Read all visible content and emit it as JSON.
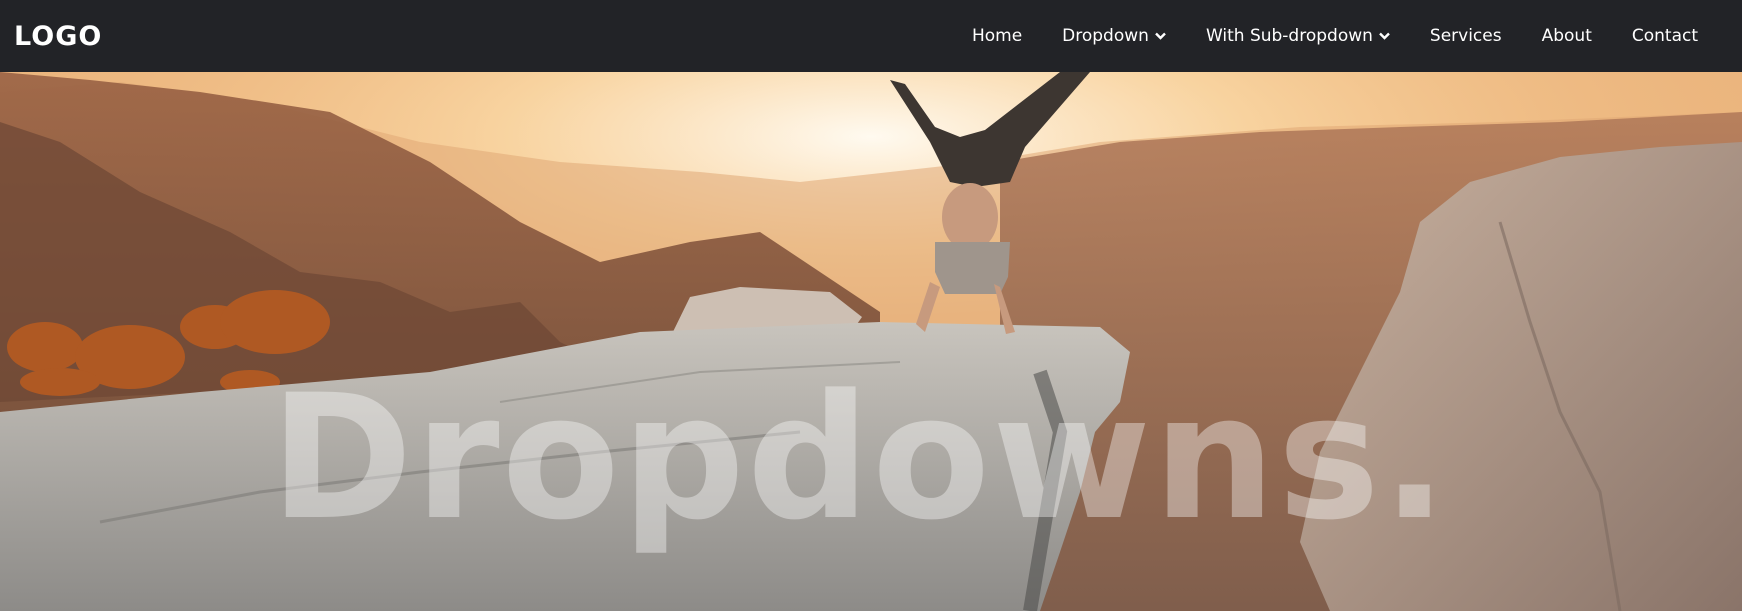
{
  "navbar": {
    "logo": "LOGO",
    "items": [
      {
        "label": "Home",
        "has_dropdown": false
      },
      {
        "label": "Dropdown",
        "has_dropdown": true
      },
      {
        "label": "With Sub-dropdown",
        "has_dropdown": true
      },
      {
        "label": "Services",
        "has_dropdown": false
      },
      {
        "label": "About",
        "has_dropdown": false
      },
      {
        "label": "Contact",
        "has_dropdown": false
      }
    ]
  },
  "hero": {
    "title": "Dropdowns."
  },
  "colors": {
    "navbar_bg": "#222327",
    "nav_text": "#ffffff",
    "hero_title": "rgba(255,255,255,0.38)"
  }
}
